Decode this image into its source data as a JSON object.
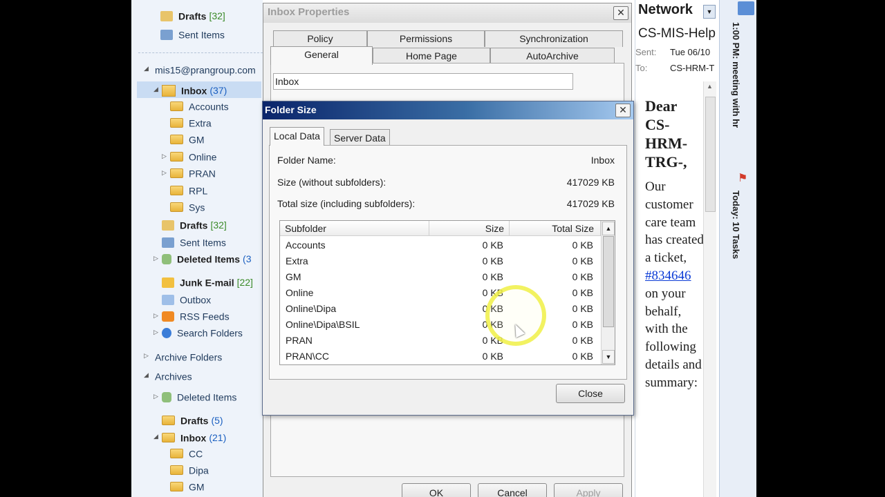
{
  "nav": {
    "top_items": [
      {
        "label": "Drafts",
        "count": "[32]"
      },
      {
        "label": "Sent Items"
      }
    ],
    "account": "mis15@prangroup.com",
    "inbox": {
      "label": "Inbox",
      "count": "(37)"
    },
    "subfolders": [
      "Accounts",
      "Extra",
      "GM",
      "Online",
      "PRAN",
      "RPL",
      "Sys"
    ],
    "drafts": {
      "label": "Drafts",
      "count": "[32]"
    },
    "sent": {
      "label": "Sent Items"
    },
    "deleted": {
      "label": "Deleted Items",
      "count": "(3"
    },
    "junk": {
      "label": "Junk E-mail",
      "count": "[22]"
    },
    "outbox": {
      "label": "Outbox"
    },
    "rss": {
      "label": "RSS Feeds"
    },
    "search": {
      "label": "Search Folders"
    },
    "archive_folders": "Archive Folders",
    "archives": "Archives",
    "arch_deleted": {
      "label": "Deleted Items"
    },
    "arch_drafts": {
      "label": "Drafts",
      "count": "(5)"
    },
    "arch_inbox": {
      "label": "Inbox",
      "count": "(21)"
    },
    "arch_subfolders": [
      "CC",
      "Dipa",
      "GM"
    ]
  },
  "props": {
    "title": "Inbox Properties",
    "close_glyph": "✕",
    "tabs_row1": [
      "Policy",
      "Permissions",
      "Synchronization"
    ],
    "tabs_row2": [
      "General",
      "Home Page",
      "AutoArchive"
    ],
    "folder_name": "Inbox",
    "ok": "OK",
    "cancel": "Cancel",
    "apply": "Apply"
  },
  "folder_size": {
    "title": "Folder Size",
    "close_glyph": "✕",
    "tabs": [
      "Local Data",
      "Server Data"
    ],
    "folder_name_label": "Folder Name:",
    "folder_name_value": "Inbox",
    "size_label": "Size (without subfolders):",
    "size_value": "417029 KB",
    "total_label": "Total size (including subfolders):",
    "total_value": "417029 KB",
    "columns": [
      "Subfolder",
      "Size",
      "Total Size"
    ],
    "rows": [
      {
        "name": "Accounts",
        "size": "0 KB",
        "total": "0 KB"
      },
      {
        "name": "Extra",
        "size": "0 KB",
        "total": "0 KB"
      },
      {
        "name": "GM",
        "size": "0 KB",
        "total": "0 KB"
      },
      {
        "name": "Online",
        "size": "0 KB",
        "total": "0 KB"
      },
      {
        "name": "Online\\Dipa",
        "size": "0 KB",
        "total": "0 KB"
      },
      {
        "name": "Online\\Dipa\\BSIL",
        "size": "0 KB",
        "total": "0 KB"
      },
      {
        "name": "PRAN",
        "size": "0 KB",
        "total": "0 KB"
      },
      {
        "name": "PRAN\\CC",
        "size": "0 KB",
        "total": "0 KB"
      }
    ],
    "close_button": "Close"
  },
  "reading": {
    "header": "Network",
    "subject": "CS-MIS-Help",
    "sent_label": "Sent:",
    "sent_value": "Tue 06/10",
    "to_label": "To:",
    "to_value": "CS-HRM-T",
    "greeting": "Dear CS-HRM-TRG-,",
    "body_before_link": "Our customer care team has created a ticket,",
    "ticket_link": "#834646",
    "body_after_link": "on your behalf, with the following details and summary:"
  },
  "todo": {
    "appointment": "1:00 PM: meeting with hr",
    "tasks": "Today: 10 Tasks"
  }
}
